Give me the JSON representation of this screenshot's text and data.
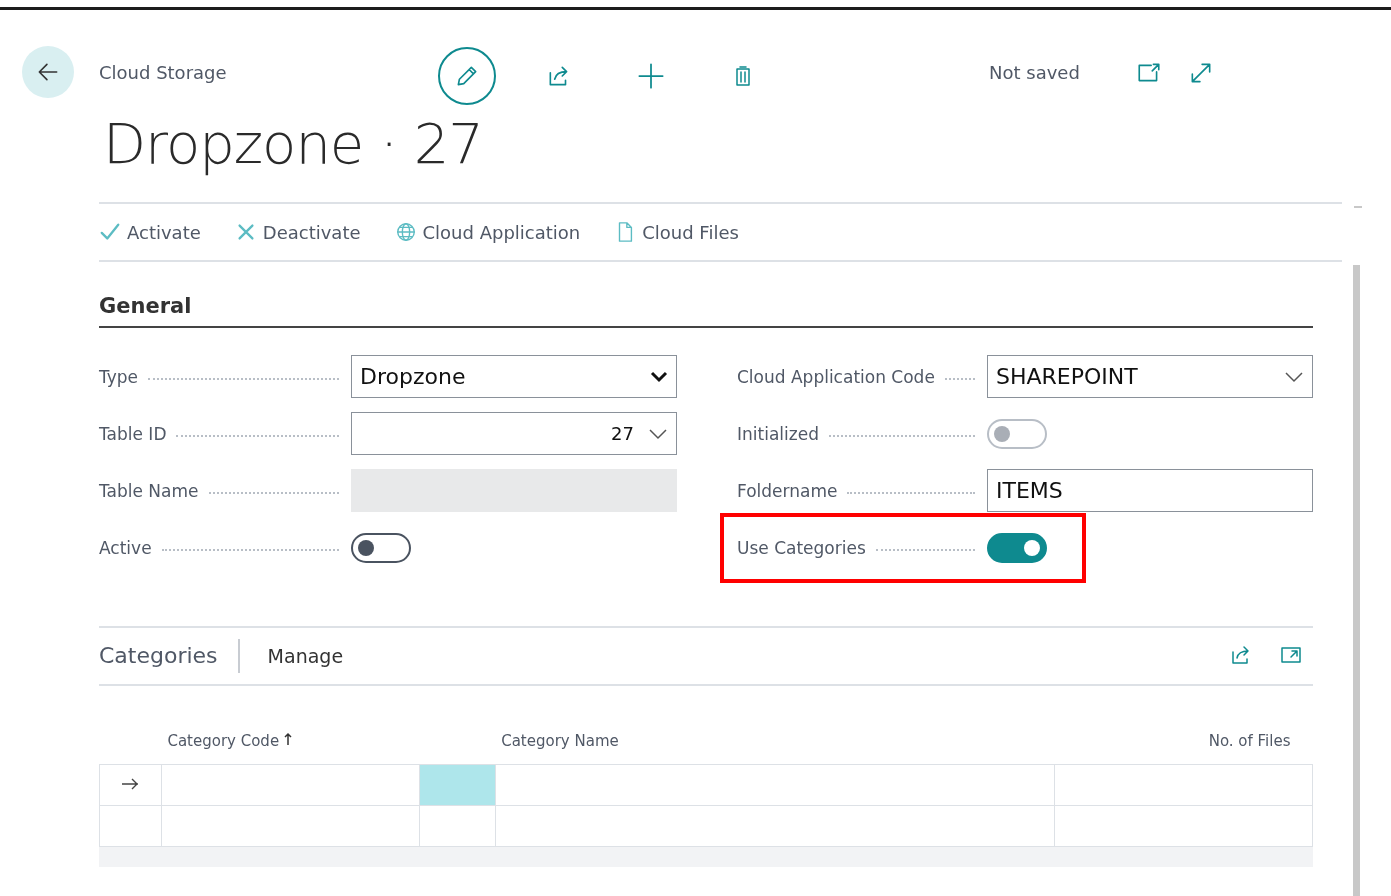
{
  "header": {
    "breadcrumb": "Cloud Storage",
    "title": "Dropzone · 27",
    "status": "Not saved"
  },
  "actions": [
    {
      "kind": "check",
      "label": "Activate"
    },
    {
      "kind": "cross",
      "label": "Deactivate"
    },
    {
      "kind": "globe",
      "label": "Cloud Application"
    },
    {
      "kind": "file",
      "label": "Cloud Files"
    }
  ],
  "general": {
    "title": "General",
    "left": [
      {
        "label": "Type",
        "kind": "select",
        "value": "Dropzone"
      },
      {
        "label": "Table ID",
        "kind": "number-select",
        "value": "27"
      },
      {
        "label": "Table Name",
        "kind": "readonly"
      },
      {
        "label": "Active",
        "kind": "toggle",
        "on": false,
        "disabled": false,
        "highlighted": false
      }
    ],
    "right": [
      {
        "label": "Cloud Application Code",
        "kind": "lookup",
        "value": "SHAREPOINT"
      },
      {
        "label": "Initialized",
        "kind": "toggle",
        "on": false,
        "disabled": true,
        "highlighted": false
      },
      {
        "label": "Foldername",
        "kind": "text",
        "value": "ITEMS"
      },
      {
        "label": "Use Categories",
        "kind": "toggle",
        "on": true,
        "disabled": false,
        "highlighted": true
      }
    ]
  },
  "categories": {
    "title": "Categories",
    "action": "Manage",
    "columns": [
      {
        "label": "Category Code",
        "sorted": true
      },
      {
        "label": "Category Name",
        "sorted": false
      },
      {
        "label": "No. of Files",
        "sorted": false
      }
    ],
    "rows": [
      {
        "current": true,
        "selected": true
      },
      {
        "current": false,
        "selected": false
      }
    ]
  }
}
